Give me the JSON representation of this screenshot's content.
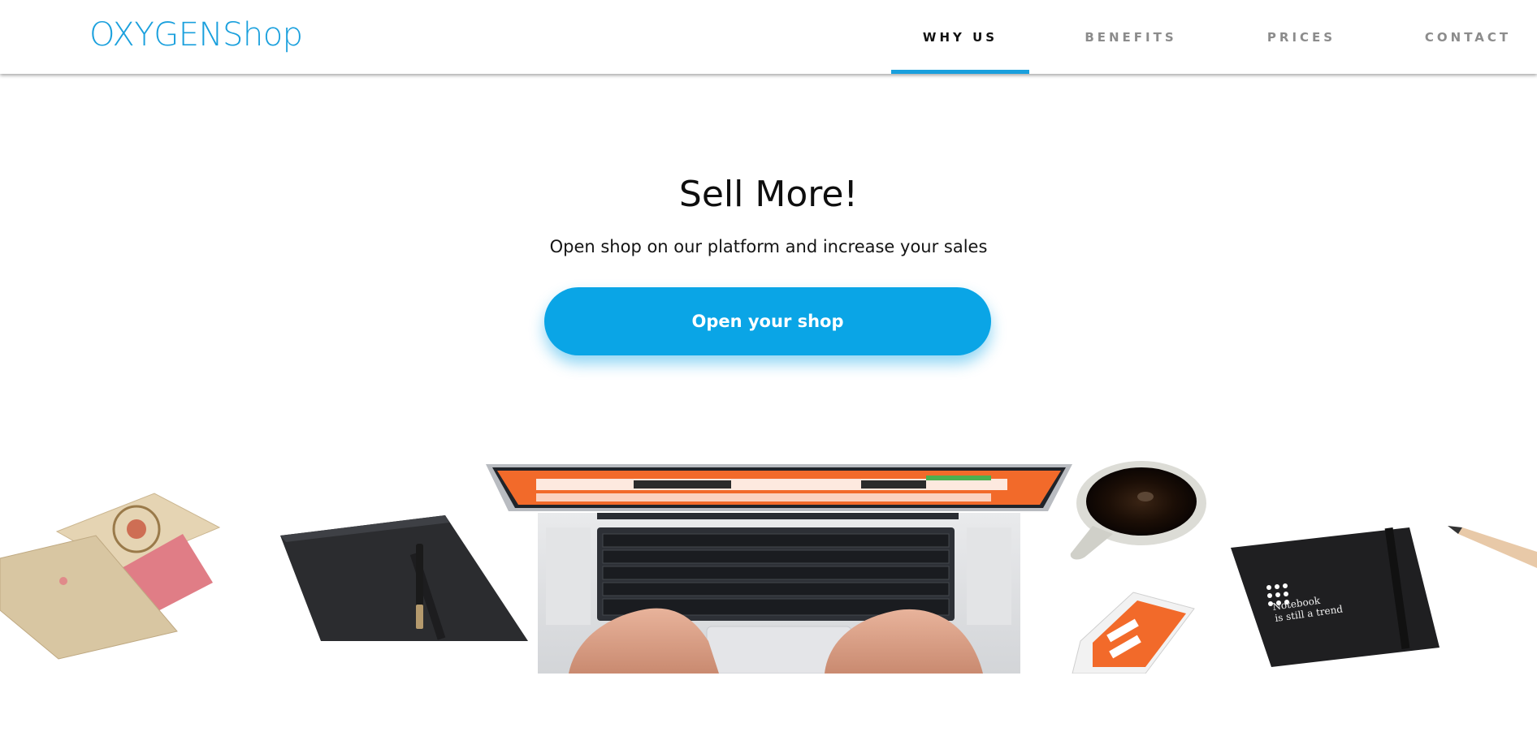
{
  "brand": {
    "logo": "OXYGENShop"
  },
  "nav": {
    "items": [
      {
        "label": "WHY US",
        "active": true
      },
      {
        "label": "BENEFITS",
        "active": false
      },
      {
        "label": "PRICES",
        "active": false
      },
      {
        "label": "CONTACT",
        "active": false
      }
    ]
  },
  "hero": {
    "title": "Sell More!",
    "subtitle": "Open shop on our platform and increase your sales",
    "cta_label": "Open your shop"
  },
  "illustration": {
    "notebook_text_line1": "Notebook",
    "notebook_text_line2": "is still a trend"
  },
  "colors": {
    "accent": "#1aa0dd",
    "button": "#0aa5e6",
    "laptop_screen_accent": "#f26a2a"
  }
}
